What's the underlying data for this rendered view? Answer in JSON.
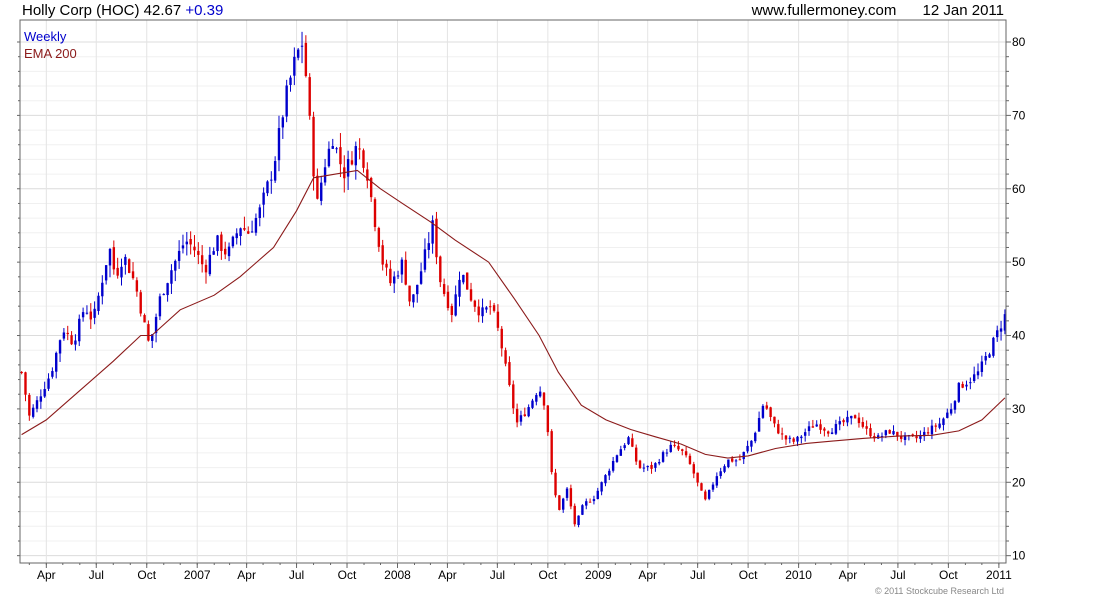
{
  "header": {
    "title": "Holly Corp (HOC) 42.67",
    "change": "+0.39",
    "website": "www.fullermoney.com",
    "date": "12 Jan 2011"
  },
  "legend": {
    "weekly": "Weekly",
    "ema": "EMA 200"
  },
  "copyright": "© 2011 Stockcube Research Ltd",
  "colors": {
    "up": "#0000cc",
    "down": "#dd0000",
    "ema": "#8b1a1a",
    "grid": "#e6e6e6"
  },
  "chart_data": {
    "type": "line",
    "ylim": [
      9,
      83
    ],
    "yticks": [
      10,
      20,
      30,
      40,
      50,
      60,
      70,
      80
    ],
    "xlim": [
      "2006-02-12",
      "2011-01-14"
    ],
    "xticks": [
      {
        "date": "2006-04-01",
        "label": "Apr"
      },
      {
        "date": "2006-07-01",
        "label": "Jul"
      },
      {
        "date": "2006-10-01",
        "label": "Oct"
      },
      {
        "date": "2007-01-01",
        "label": "2007"
      },
      {
        "date": "2007-04-01",
        "label": "Apr"
      },
      {
        "date": "2007-07-01",
        "label": "Jul"
      },
      {
        "date": "2007-10-01",
        "label": "Oct"
      },
      {
        "date": "2008-01-01",
        "label": "2008"
      },
      {
        "date": "2008-04-01",
        "label": "Apr"
      },
      {
        "date": "2008-07-01",
        "label": "Jul"
      },
      {
        "date": "2008-10-01",
        "label": "Oct"
      },
      {
        "date": "2009-01-01",
        "label": "2009"
      },
      {
        "date": "2009-04-01",
        "label": "Apr"
      },
      {
        "date": "2009-07-01",
        "label": "Jul"
      },
      {
        "date": "2009-10-01",
        "label": "Oct"
      },
      {
        "date": "2010-01-01",
        "label": "2010"
      },
      {
        "date": "2010-04-01",
        "label": "Apr"
      },
      {
        "date": "2010-07-01",
        "label": "Jul"
      },
      {
        "date": "2010-10-01",
        "label": "Oct"
      },
      {
        "date": "2011-01-01",
        "label": "2011"
      }
    ],
    "price_path": [
      [
        "2006-02-15",
        35
      ],
      [
        "2006-03-01",
        29
      ],
      [
        "2006-03-15",
        31
      ],
      [
        "2006-04-10",
        35
      ],
      [
        "2006-05-01",
        41
      ],
      [
        "2006-05-20",
        39
      ],
      [
        "2006-06-10",
        44
      ],
      [
        "2006-06-25",
        42
      ],
      [
        "2006-07-25",
        52
      ],
      [
        "2006-08-05",
        48
      ],
      [
        "2006-08-20",
        51
      ],
      [
        "2006-09-10",
        47
      ],
      [
        "2006-09-25",
        42
      ],
      [
        "2006-10-06",
        38.5
      ],
      [
        "2006-10-25",
        45
      ],
      [
        "2006-11-15",
        49
      ],
      [
        "2006-12-10",
        53
      ],
      [
        "2006-12-25",
        52
      ],
      [
        "2007-01-15",
        49
      ],
      [
        "2007-02-05",
        53
      ],
      [
        "2007-02-25",
        51
      ],
      [
        "2007-03-20",
        55
      ],
      [
        "2007-04-05",
        54
      ],
      [
        "2007-04-25",
        57
      ],
      [
        "2007-05-20",
        63
      ],
      [
        "2007-06-10",
        72
      ],
      [
        "2007-06-30",
        78
      ],
      [
        "2007-07-12",
        80
      ],
      [
        "2007-07-20",
        74
      ],
      [
        "2007-07-30",
        64
      ],
      [
        "2007-08-08",
        58
      ],
      [
        "2007-08-20",
        63
      ],
      [
        "2007-09-05",
        67
      ],
      [
        "2007-09-25",
        62
      ],
      [
        "2007-10-20",
        66
      ],
      [
        "2007-11-05",
        63
      ],
      [
        "2007-11-20",
        56
      ],
      [
        "2007-12-05",
        50
      ],
      [
        "2007-12-20",
        47
      ],
      [
        "2008-01-10",
        50
      ],
      [
        "2008-01-25",
        44
      ],
      [
        "2008-02-10",
        48
      ],
      [
        "2008-03-05",
        55
      ],
      [
        "2008-03-20",
        47
      ],
      [
        "2008-04-10",
        43
      ],
      [
        "2008-04-25",
        49
      ],
      [
        "2008-05-15",
        45
      ],
      [
        "2008-06-01",
        43
      ],
      [
        "2008-06-20",
        44
      ],
      [
        "2008-07-05",
        40
      ],
      [
        "2008-07-20",
        34
      ],
      [
        "2008-08-05",
        28
      ],
      [
        "2008-08-25",
        30
      ],
      [
        "2008-09-15",
        33
      ],
      [
        "2008-09-28",
        30
      ],
      [
        "2008-10-06",
        22
      ],
      [
        "2008-10-20",
        16
      ],
      [
        "2008-11-05",
        19
      ],
      [
        "2008-11-20",
        14
      ],
      [
        "2008-12-05",
        17
      ],
      [
        "2008-12-25",
        18
      ],
      [
        "2009-01-15",
        21
      ],
      [
        "2009-02-05",
        24
      ],
      [
        "2009-02-25",
        26
      ],
      [
        "2009-03-15",
        22
      ],
      [
        "2009-04-10",
        22
      ],
      [
        "2009-05-01",
        24
      ],
      [
        "2009-05-15",
        25
      ],
      [
        "2009-06-05",
        24
      ],
      [
        "2009-06-20",
        22
      ],
      [
        "2009-07-05",
        19
      ],
      [
        "2009-07-15",
        17.5
      ],
      [
        "2009-08-05",
        21
      ],
      [
        "2009-08-25",
        23
      ],
      [
        "2009-09-15",
        23
      ],
      [
        "2009-10-10",
        26
      ],
      [
        "2009-10-30",
        31
      ],
      [
        "2009-11-15",
        28
      ],
      [
        "2009-12-05",
        26
      ],
      [
        "2009-12-25",
        25.5
      ],
      [
        "2010-01-15",
        27
      ],
      [
        "2010-02-01",
        28
      ],
      [
        "2010-02-25",
        27
      ],
      [
        "2010-03-20",
        28
      ],
      [
        "2010-04-15",
        29
      ],
      [
        "2010-05-05",
        27
      ],
      [
        "2010-05-25",
        26
      ],
      [
        "2010-06-15",
        27
      ],
      [
        "2010-07-10",
        26
      ],
      [
        "2010-08-05",
        26
      ],
      [
        "2010-08-25",
        27
      ],
      [
        "2010-09-15",
        28
      ],
      [
        "2010-10-05",
        30
      ],
      [
        "2010-10-20",
        33
      ],
      [
        "2010-11-10",
        34
      ],
      [
        "2010-11-25",
        35
      ],
      [
        "2010-12-15",
        38
      ],
      [
        "2011-01-12",
        42.67
      ]
    ],
    "ema_path": [
      [
        "2006-02-15",
        26.5
      ],
      [
        "2006-04-01",
        28.5
      ],
      [
        "2006-06-01",
        32.5
      ],
      [
        "2006-08-01",
        36.5
      ],
      [
        "2006-09-20",
        40
      ],
      [
        "2006-10-10",
        40
      ],
      [
        "2006-12-01",
        43.5
      ],
      [
        "2007-02-01",
        45.5
      ],
      [
        "2007-03-20",
        48
      ],
      [
        "2007-05-20",
        52
      ],
      [
        "2007-07-01",
        57
      ],
      [
        "2007-08-01",
        61.5
      ],
      [
        "2007-09-10",
        62
      ],
      [
        "2007-10-20",
        62.5
      ],
      [
        "2007-12-01",
        60
      ],
      [
        "2008-01-10",
        58
      ],
      [
        "2008-03-01",
        55.5
      ],
      [
        "2008-04-15",
        53
      ],
      [
        "2008-06-15",
        50
      ],
      [
        "2008-08-01",
        45
      ],
      [
        "2008-09-15",
        40
      ],
      [
        "2008-10-20",
        35
      ],
      [
        "2008-12-01",
        30.5
      ],
      [
        "2009-01-15",
        28.5
      ],
      [
        "2009-03-01",
        27.2
      ],
      [
        "2009-04-15",
        26.2
      ],
      [
        "2009-06-01",
        25.2
      ],
      [
        "2009-07-15",
        23.8
      ],
      [
        "2009-08-25",
        23.3
      ],
      [
        "2009-10-01",
        23.6
      ],
      [
        "2009-11-20",
        24.6
      ],
      [
        "2010-01-15",
        25.3
      ],
      [
        "2010-03-01",
        25.6
      ],
      [
        "2010-05-01",
        26.0
      ],
      [
        "2010-07-01",
        26.3
      ],
      [
        "2010-09-01",
        26.4
      ],
      [
        "2010-10-20",
        27.0
      ],
      [
        "2010-12-01",
        28.5
      ],
      [
        "2011-01-12",
        31.5
      ]
    ]
  }
}
